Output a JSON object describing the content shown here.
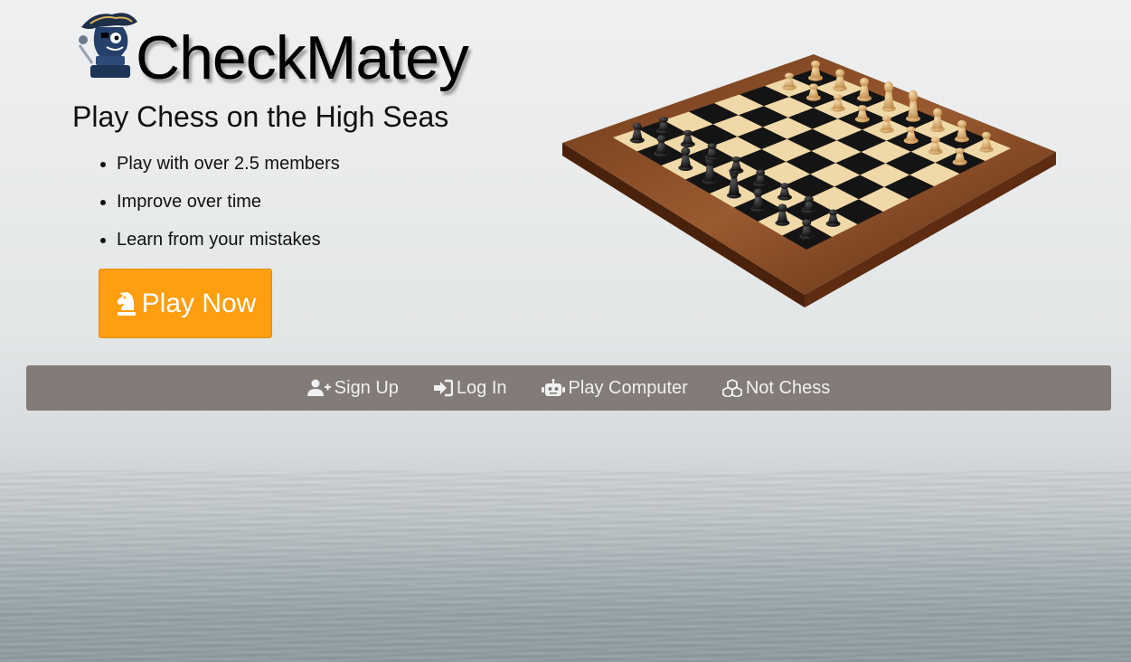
{
  "brand": {
    "name": "CheckMatey",
    "tagline": "Play Chess on the High Seas"
  },
  "features": [
    "Play with over 2.5 members",
    "Improve over time",
    "Learn from your mistakes"
  ],
  "cta": {
    "label": "Play Now",
    "icon": "chess-knight-icon",
    "color": "#ff9e0f"
  },
  "nav": {
    "background": "#827b78",
    "items": [
      {
        "label": "Sign Up",
        "icon": "user-plus-icon"
      },
      {
        "label": "Log In",
        "icon": "sign-in-icon"
      },
      {
        "label": "Play Computer",
        "icon": "robot-icon"
      },
      {
        "label": "Not Chess",
        "icon": "cubes-icon"
      }
    ]
  }
}
